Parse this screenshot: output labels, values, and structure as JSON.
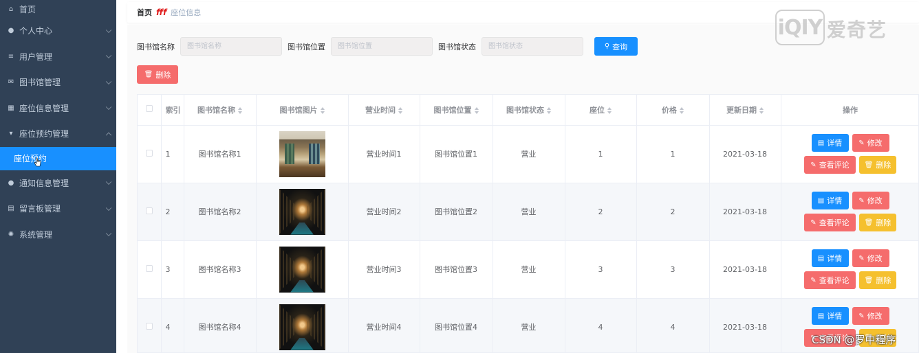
{
  "sidebar": {
    "items": [
      {
        "label": "首页",
        "icon": "home-icon"
      },
      {
        "label": "个人中心",
        "icon": "user-icon"
      },
      {
        "label": "用户管理",
        "icon": "list-icon"
      },
      {
        "label": "图书馆管理",
        "icon": "mail-icon"
      },
      {
        "label": "座位信息管理",
        "icon": "building-icon"
      },
      {
        "label": "座位预约管理",
        "icon": "cup-icon"
      },
      {
        "label": "通知信息管理",
        "icon": "user-icon"
      },
      {
        "label": "留言板管理",
        "icon": "clipboard-icon"
      },
      {
        "label": "系统管理",
        "icon": "gear-icon"
      }
    ],
    "active_sub": "座位预约"
  },
  "breadcrumb": {
    "home": "首页",
    "current": "座位信息"
  },
  "search": {
    "name_label": "图书馆名称",
    "name_placeholder": "图书馆名称",
    "location_label": "图书馆位置",
    "location_placeholder": "图书馆位置",
    "status_label": "图书馆状态",
    "status_placeholder": "图书馆状态",
    "query_label": "查询"
  },
  "toolbar": {
    "delete_label": "删除"
  },
  "table": {
    "headers": [
      "索引",
      "图书馆名称",
      "图书馆图片",
      "营业时间",
      "图书馆位置",
      "图书馆状态",
      "座位",
      "价格",
      "更新日期",
      "操作"
    ],
    "rows": [
      {
        "index": "1",
        "name": "图书馆名称1",
        "hours": "营业时间1",
        "location": "图书馆位置1",
        "status": "营业",
        "seat": "1",
        "price": "1",
        "date": "2021-03-18"
      },
      {
        "index": "2",
        "name": "图书馆名称2",
        "hours": "营业时间2",
        "location": "图书馆位置2",
        "status": "营业",
        "seat": "2",
        "price": "2",
        "date": "2021-03-18"
      },
      {
        "index": "3",
        "name": "图书馆名称3",
        "hours": "营业时间3",
        "location": "图书馆位置3",
        "status": "营业",
        "seat": "3",
        "price": "3",
        "date": "2021-03-18"
      },
      {
        "index": "4",
        "name": "图书馆名称4",
        "hours": "营业时间4",
        "location": "图书馆位置4",
        "status": "营业",
        "seat": "4",
        "price": "4",
        "date": "2021-03-18"
      }
    ],
    "actions": {
      "detail": "详情",
      "edit": "修改",
      "review": "查看评论",
      "delete": "删除"
    }
  },
  "watermarks": {
    "iqiyi_logo": "iQIY",
    "iqiyi_text": "爱奇艺",
    "csdn": "CSDN @罗中程序"
  },
  "colors": {
    "sidebar_bg": "#304156",
    "primary": "#1890ff",
    "danger": "#f56c6c",
    "warning": "#f5c02e"
  }
}
